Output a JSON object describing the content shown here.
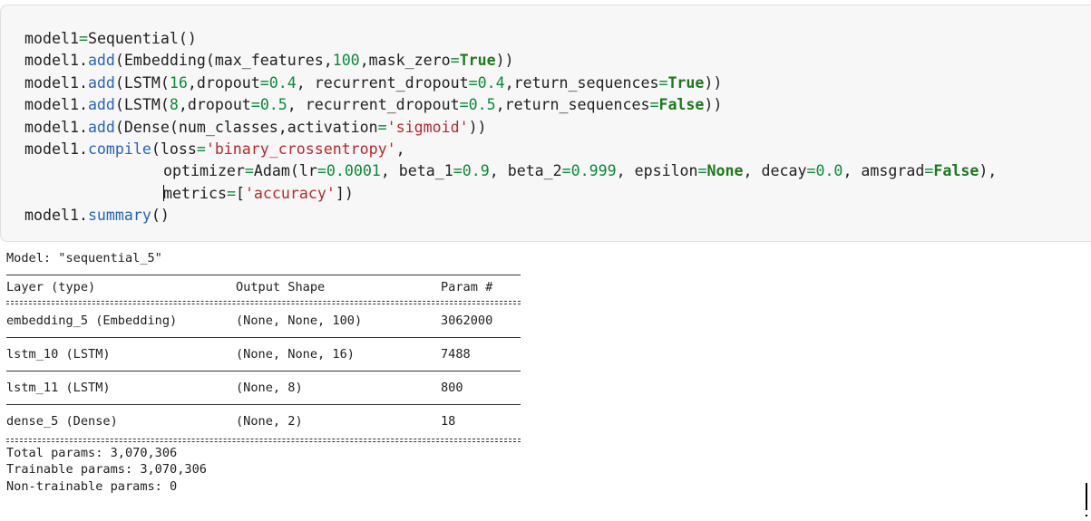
{
  "code_cell": {
    "lines": [
      {
        "tokens": [
          {
            "t": "model1",
            "c": ""
          },
          {
            "t": "=",
            "c": "op"
          },
          {
            "t": "Sequential()",
            "c": ""
          }
        ]
      },
      {
        "tokens": [
          {
            "t": "model1.",
            "c": ""
          },
          {
            "t": "add",
            "c": "fn"
          },
          {
            "t": "(Embedding(max_features,",
            "c": ""
          },
          {
            "t": "100",
            "c": "num"
          },
          {
            "t": ",mask_zero",
            "c": ""
          },
          {
            "t": "=",
            "c": "op"
          },
          {
            "t": "True",
            "c": "kw"
          },
          {
            "t": "))",
            "c": ""
          }
        ]
      },
      {
        "tokens": [
          {
            "t": "model1.",
            "c": ""
          },
          {
            "t": "add",
            "c": "fn"
          },
          {
            "t": "(LSTM(",
            "c": ""
          },
          {
            "t": "16",
            "c": "num"
          },
          {
            "t": ",dropout",
            "c": ""
          },
          {
            "t": "=",
            "c": "op"
          },
          {
            "t": "0.4",
            "c": "num"
          },
          {
            "t": ", recurrent_dropout",
            "c": ""
          },
          {
            "t": "=",
            "c": "op"
          },
          {
            "t": "0.4",
            "c": "num"
          },
          {
            "t": ",return_sequences",
            "c": ""
          },
          {
            "t": "=",
            "c": "op"
          },
          {
            "t": "True",
            "c": "kw"
          },
          {
            "t": "))",
            "c": ""
          }
        ]
      },
      {
        "tokens": [
          {
            "t": "model1.",
            "c": ""
          },
          {
            "t": "add",
            "c": "fn"
          },
          {
            "t": "(LSTM(",
            "c": ""
          },
          {
            "t": "8",
            "c": "num"
          },
          {
            "t": ",dropout",
            "c": ""
          },
          {
            "t": "=",
            "c": "op"
          },
          {
            "t": "0.5",
            "c": "num"
          },
          {
            "t": ", recurrent_dropout",
            "c": ""
          },
          {
            "t": "=",
            "c": "op"
          },
          {
            "t": "0.5",
            "c": "num"
          },
          {
            "t": ",return_sequences",
            "c": ""
          },
          {
            "t": "=",
            "c": "op"
          },
          {
            "t": "False",
            "c": "kw"
          },
          {
            "t": "))",
            "c": ""
          }
        ]
      },
      {
        "tokens": [
          {
            "t": "model1.",
            "c": ""
          },
          {
            "t": "add",
            "c": "fn"
          },
          {
            "t": "(Dense(num_classes,activation",
            "c": ""
          },
          {
            "t": "=",
            "c": "op"
          },
          {
            "t": "'sigmoid'",
            "c": "str"
          },
          {
            "t": "))",
            "c": ""
          }
        ]
      },
      {
        "tokens": [
          {
            "t": "model1.",
            "c": ""
          },
          {
            "t": "compile",
            "c": "fn"
          },
          {
            "t": "(loss",
            "c": ""
          },
          {
            "t": "=",
            "c": "op"
          },
          {
            "t": "'binary_crossentropy'",
            "c": "str"
          },
          {
            "t": ",",
            "c": ""
          }
        ]
      },
      {
        "indent": true,
        "tokens": [
          {
            "t": "optimizer",
            "c": ""
          },
          {
            "t": "=",
            "c": "op"
          },
          {
            "t": "Adam(lr",
            "c": ""
          },
          {
            "t": "=",
            "c": "op"
          },
          {
            "t": "0.0001",
            "c": "num"
          },
          {
            "t": ", beta_1",
            "c": ""
          },
          {
            "t": "=",
            "c": "op"
          },
          {
            "t": "0.9",
            "c": "num"
          },
          {
            "t": ", beta_2",
            "c": ""
          },
          {
            "t": "=",
            "c": "op"
          },
          {
            "t": "0.999",
            "c": "num"
          },
          {
            "t": ", epsilon",
            "c": ""
          },
          {
            "t": "=",
            "c": "op"
          },
          {
            "t": "None",
            "c": "kw"
          },
          {
            "t": ", decay",
            "c": ""
          },
          {
            "t": "=",
            "c": "op"
          },
          {
            "t": "0.0",
            "c": "num"
          },
          {
            "t": ", amsgrad",
            "c": ""
          },
          {
            "t": "=",
            "c": "op"
          },
          {
            "t": "False",
            "c": "kw"
          },
          {
            "t": "),",
            "c": ""
          }
        ]
      },
      {
        "indent": true,
        "caret": true,
        "tokens": [
          {
            "t": "metrics",
            "c": ""
          },
          {
            "t": "=",
            "c": "op"
          },
          {
            "t": "[",
            "c": ""
          },
          {
            "t": "'accuracy'",
            "c": "str"
          },
          {
            "t": "])",
            "c": ""
          }
        ]
      },
      {
        "tokens": [
          {
            "t": "model1.",
            "c": ""
          },
          {
            "t": "summary",
            "c": "fn"
          },
          {
            "t": "()",
            "c": ""
          }
        ]
      }
    ]
  },
  "output": {
    "model_line": "Model: \"sequential_5\"",
    "headers": {
      "layer": "Layer (type)",
      "shape": "Output Shape",
      "params": "Param #"
    },
    "rows": [
      {
        "layer": "embedding_5 (Embedding)",
        "shape": "(None, None, 100)",
        "params": "3062000"
      },
      {
        "layer": "lstm_10 (LSTM)",
        "shape": "(None, None, 16)",
        "params": "7488"
      },
      {
        "layer": "lstm_11 (LSTM)",
        "shape": "(None, 8)",
        "params": "800"
      },
      {
        "layer": "dense_5 (Dense)",
        "shape": "(None, 2)",
        "params": "18"
      }
    ],
    "total_params": "Total params: 3,070,306",
    "trainable_params": "Trainable params: 3,070,306",
    "non_trainable_params": "Non-trainable params: 0"
  }
}
